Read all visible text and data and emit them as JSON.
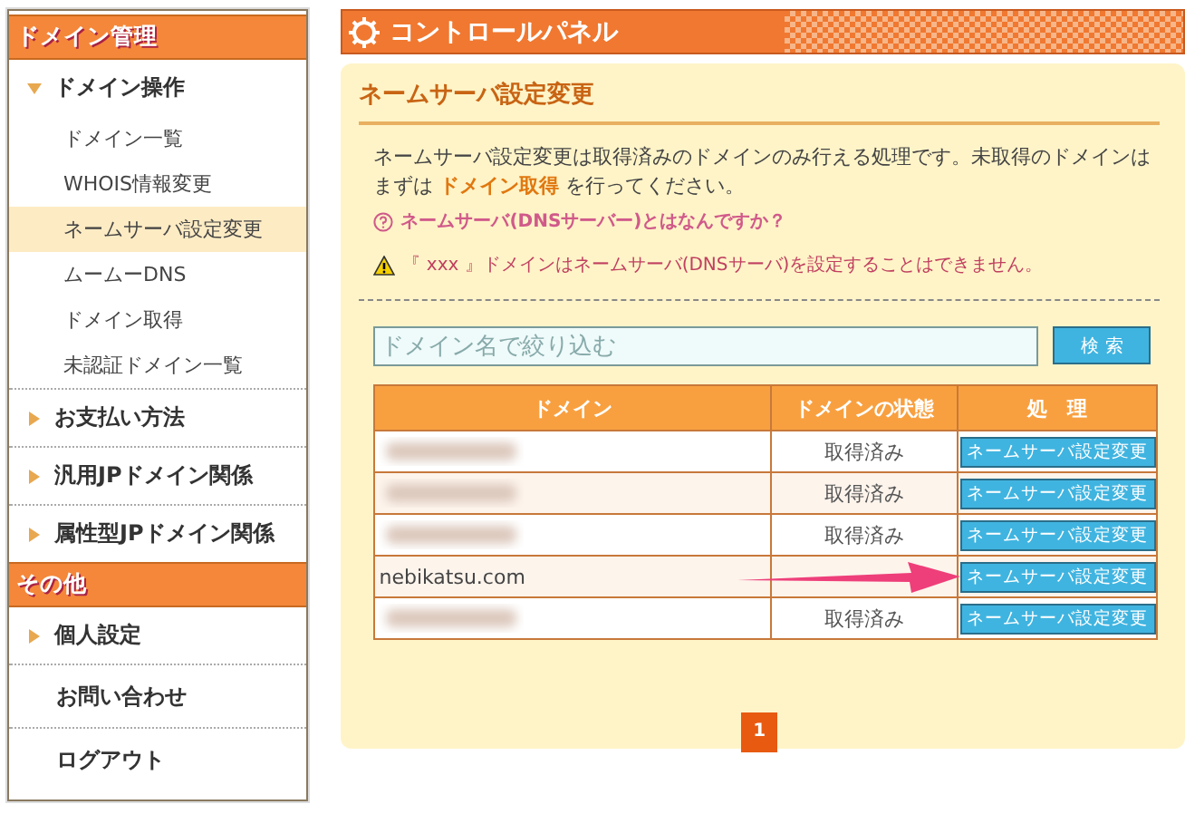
{
  "sidebar": {
    "sections": [
      {
        "title": "ドメイン管理",
        "items": [
          {
            "label": "ドメイン操作",
            "kind": "group",
            "expanded": true,
            "children": [
              {
                "label": "ドメイン一覧",
                "selected": false
              },
              {
                "label": "WHOIS情報変更",
                "selected": false
              },
              {
                "label": "ネームサーバ設定変更",
                "selected": true
              },
              {
                "label": "ムームーDNS",
                "selected": false
              },
              {
                "label": "ドメイン取得",
                "selected": false
              },
              {
                "label": "未認証ドメイン一覧",
                "selected": false
              }
            ]
          },
          {
            "label": "お支払い方法",
            "kind": "group",
            "expanded": false
          },
          {
            "label": "汎用JPドメイン関係",
            "kind": "group",
            "expanded": false
          },
          {
            "label": "属性型JPドメイン関係",
            "kind": "group",
            "expanded": false
          }
        ]
      },
      {
        "title": "その他",
        "items": [
          {
            "label": "個人設定",
            "kind": "group",
            "expanded": false
          },
          {
            "label": "お問い合わせ",
            "kind": "link"
          },
          {
            "label": "ログアウト",
            "kind": "link"
          }
        ]
      }
    ]
  },
  "header": {
    "title": "コントロールパネル"
  },
  "panel": {
    "heading": "ネームサーバ設定変更",
    "intro": "ネームサーバ設定変更は取得済みのドメインのみ行える処理です。未取得のドメインはまずは **ドメイン取得** を行ってください。",
    "help_link": "ネームサーバ(DNSサーバー)とはなんですか？",
    "warning": "『 xxx 』ドメインはネームサーバ(DNSサーバ)を設定することはできません。",
    "search": {
      "placeholder": "ドメイン名で絞り込む",
      "button": "検 索"
    },
    "table": {
      "columns": [
        "ドメイン",
        "ドメインの状態",
        "処　理"
      ],
      "rows": [
        {
          "blurred": true,
          "status": "取得済み",
          "action": "ネームサーバ設定変更",
          "pointed": false
        },
        {
          "blurred": true,
          "status": "取得済み",
          "action": "ネームサーバ設定変更",
          "pointed": false
        },
        {
          "blurred": true,
          "status": "取得済み",
          "action": "ネームサーバ設定変更",
          "pointed": false
        },
        {
          "blurred": false,
          "domain": "nebikatsu.com",
          "action": "ネームサーバ設定変更",
          "pointed": true
        },
        {
          "blurred": true,
          "status": "取得済み",
          "action": "ネームサーバ設定変更",
          "pointed": false
        }
      ]
    },
    "pages": [
      {
        "label": "1",
        "selected": true
      }
    ]
  }
}
